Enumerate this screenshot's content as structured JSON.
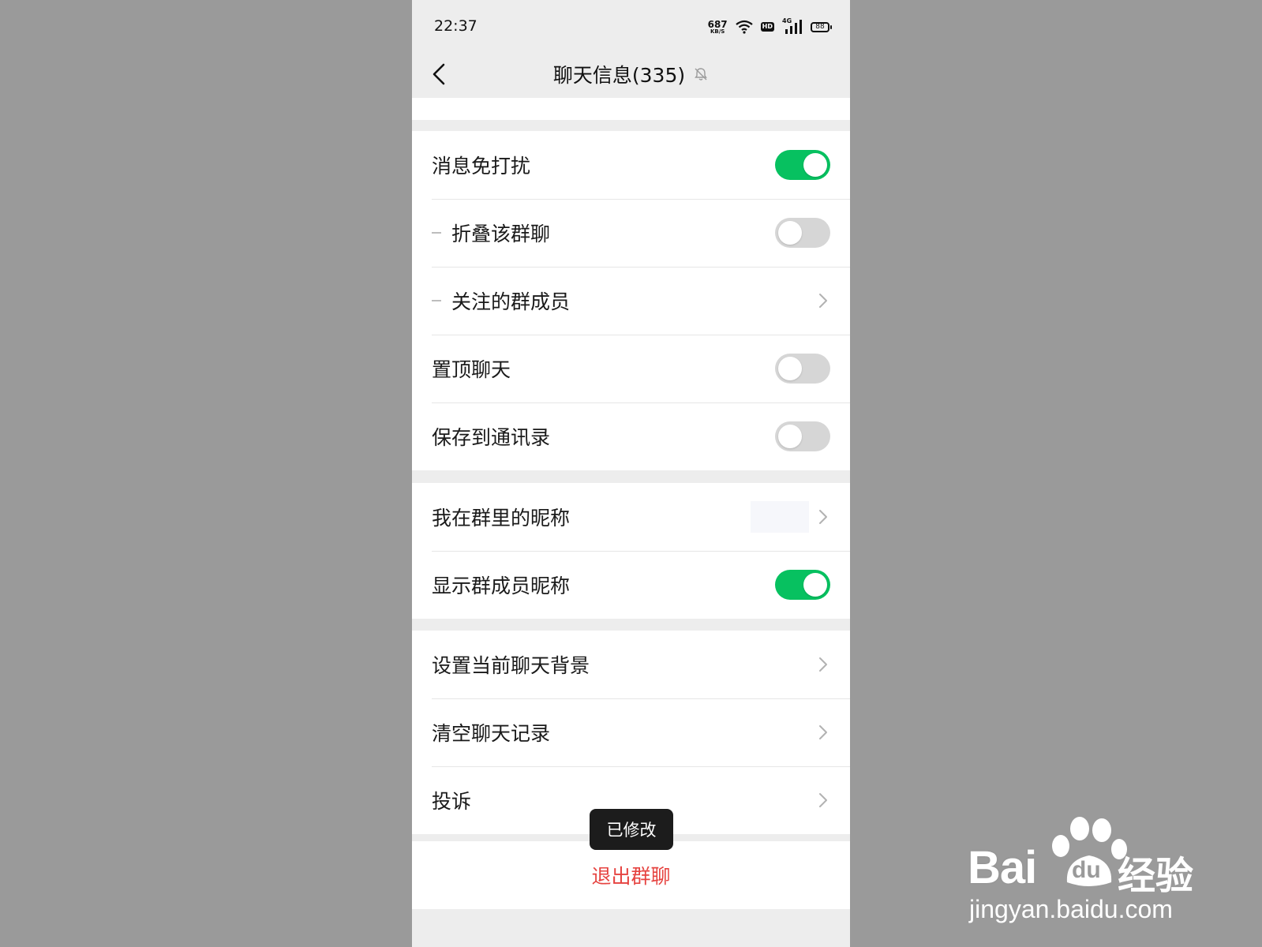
{
  "status_bar": {
    "time": "22:37",
    "net_speed_value": "687",
    "net_speed_unit": "KB/S",
    "hd_label": "HD",
    "network_type": "4G",
    "battery_level": "88"
  },
  "nav": {
    "title": "聊天信息(335)",
    "back_icon": "chevron-left-icon",
    "muted_icon": "bell-off-icon"
  },
  "section_notifications": {
    "do_not_disturb": {
      "label": "消息免打扰",
      "enabled": true
    },
    "fold_chat": {
      "label": "折叠该群聊",
      "enabled": false
    },
    "followed_members": {
      "label": "关注的群成员"
    },
    "pin_chat": {
      "label": "置顶聊天",
      "enabled": false
    },
    "save_to_contacts": {
      "label": "保存到通讯录",
      "enabled": false
    }
  },
  "section_nickname": {
    "my_nickname": {
      "label": "我在群里的昵称",
      "value": ""
    },
    "show_nicknames": {
      "label": "显示群成员昵称",
      "enabled": true
    }
  },
  "section_misc": {
    "set_background": {
      "label": "设置当前聊天背景"
    },
    "clear_history": {
      "label": "清空聊天记录"
    },
    "report": {
      "label": "投诉"
    }
  },
  "toast": {
    "text": "已修改"
  },
  "exit": {
    "label": "退出群聊"
  },
  "watermark": {
    "brand": "Bai",
    "brand_suffix": "du",
    "product": "经验",
    "url": "jingyan.baidu.com"
  },
  "colors": {
    "accent_green": "#07c160",
    "danger_red": "#e64340",
    "toggle_off": "#d6d6d6",
    "background": "#ededed"
  }
}
